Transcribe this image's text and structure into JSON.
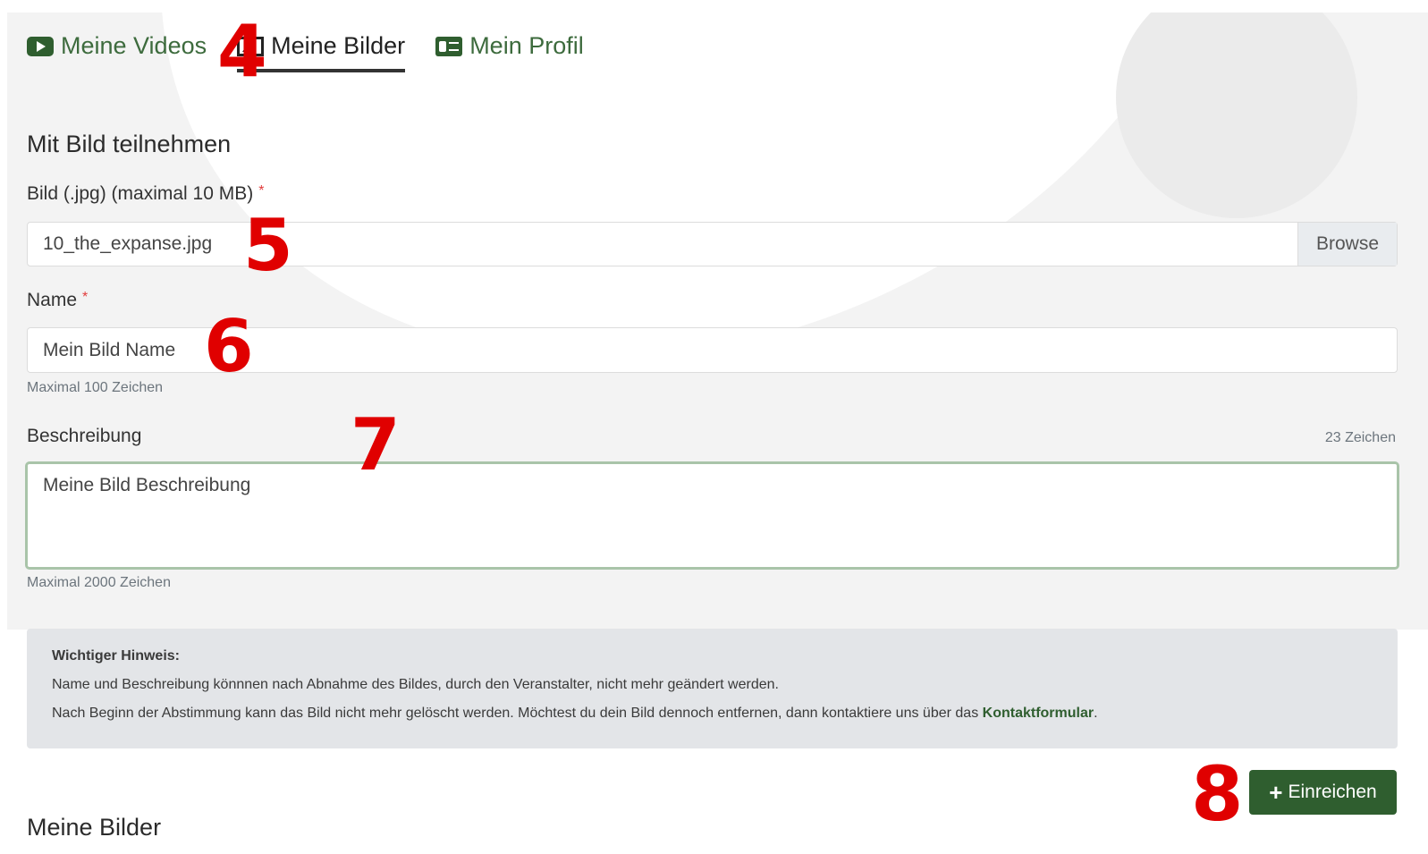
{
  "tabs": [
    {
      "label": "Meine Videos",
      "icon": "video-icon",
      "active": false
    },
    {
      "label": "Meine Bilder",
      "icon": "image-icon",
      "active": true
    },
    {
      "label": "Mein Profil",
      "icon": "profile-card-icon",
      "active": false
    }
  ],
  "form": {
    "section_title": "Mit Bild teilnehmen",
    "file": {
      "label": "Bild (.jpg) (maximal 10 MB)",
      "required_mark": "*",
      "value": "10_the_expanse.jpg",
      "browse_label": "Browse"
    },
    "name": {
      "label": "Name",
      "required_mark": "*",
      "value": "Mein Bild Name",
      "hint": "Maximal 100 Zeichen"
    },
    "description": {
      "label": "Beschreibung",
      "char_count": "23 Zeichen",
      "value": "Meine Bild Beschreibung",
      "hint": "Maximal 2000 Zeichen"
    }
  },
  "notice": {
    "title": "Wichtiger Hinweis:",
    "line1": "Name und Beschreibung könnnen nach Abnahme des Bildes, durch den Veranstalter, nicht mehr geändert werden.",
    "line2_prefix": "Nach Beginn der Abstimmung kann das Bild nicht mehr gelöscht werden. Möchtest du dein Bild dennoch entfernen, dann kontaktiere uns über das",
    "link": "Kontaktformular",
    "line2_suffix": "."
  },
  "submit": {
    "label": "Einreichen",
    "icon": "plus-icon"
  },
  "bottom_title": "Meine Bilder",
  "markers": {
    "m4": "4",
    "m5": "5",
    "m6": "6",
    "m7": "7",
    "m8": "8"
  },
  "colors": {
    "accent": "#2f5e2f",
    "marker": "#e00000",
    "required": "#e23b3b"
  }
}
